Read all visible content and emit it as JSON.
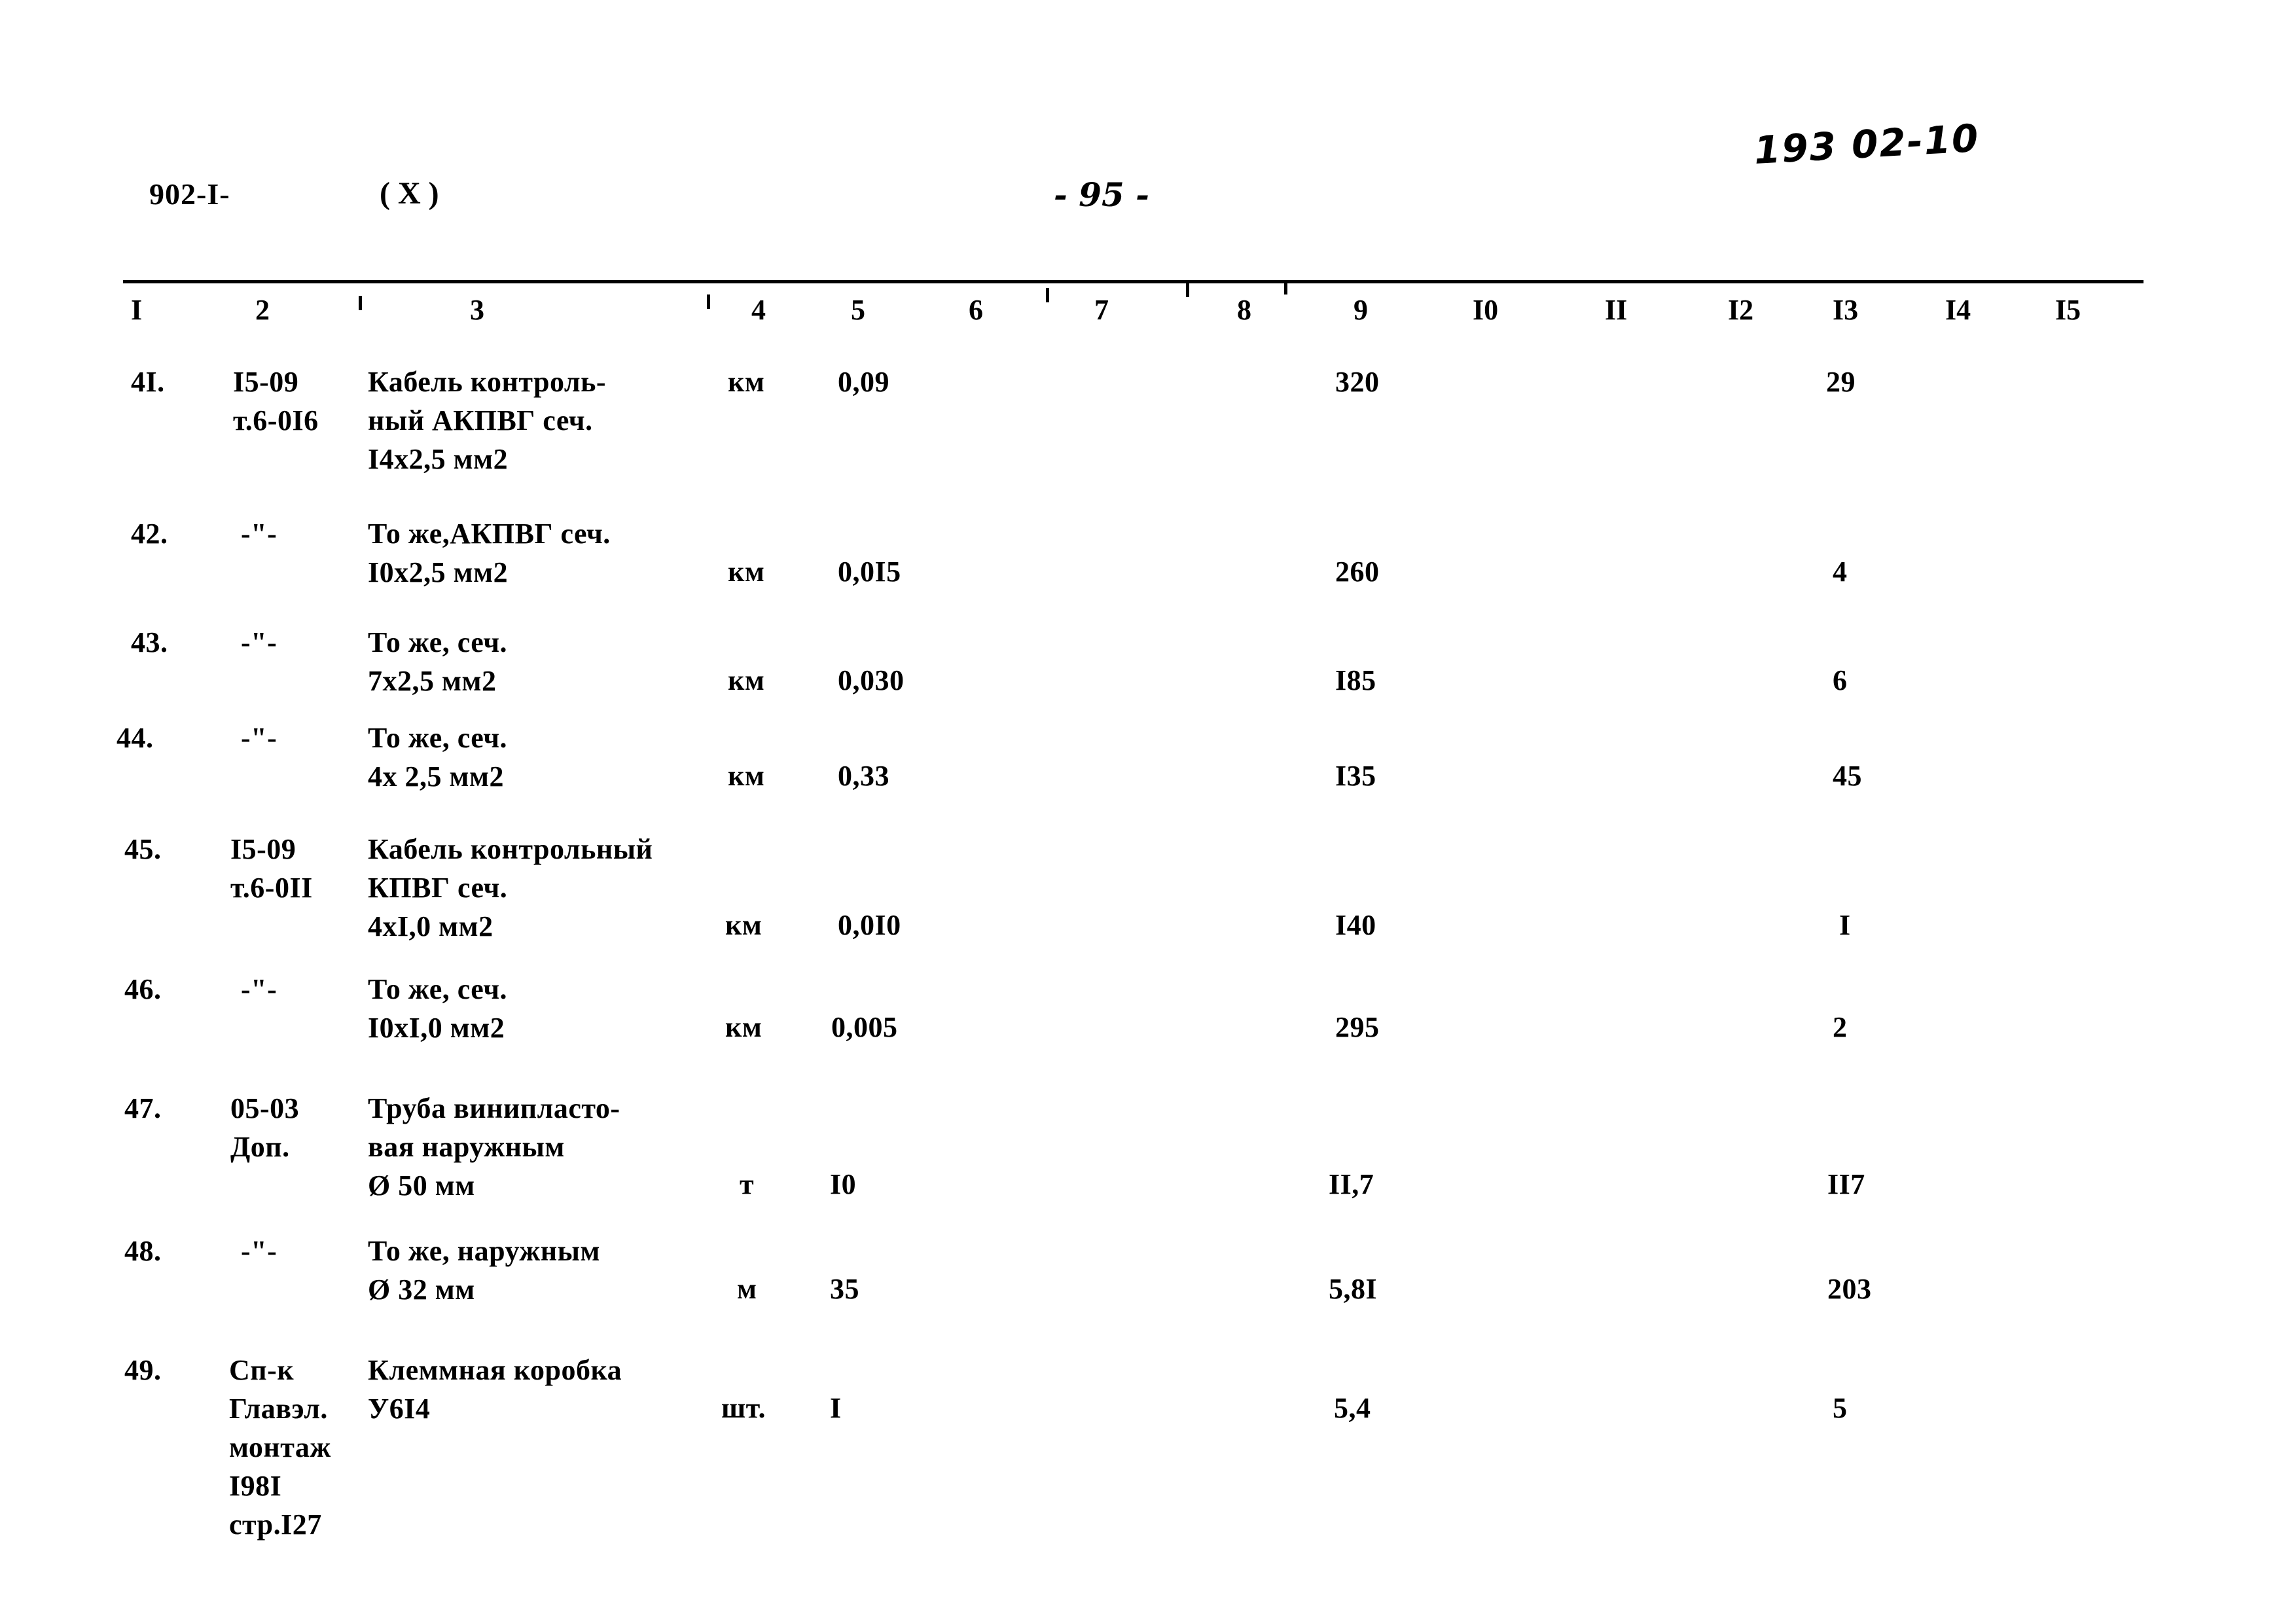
{
  "header": {
    "doc_code": "902-I-",
    "variant": "( X )",
    "page_number": "- 95 -",
    "handwritten_note": "193 02-10"
  },
  "table": {
    "column_headers": [
      "I",
      "2",
      "3",
      "4",
      "5",
      "6",
      "7",
      "8",
      "9",
      "I0",
      "II",
      "I2",
      "I3",
      "I4",
      "I5"
    ],
    "rows": [
      {
        "num": "4I.",
        "code": "I5-09\nт.6-0I6",
        "name": "Кабель контроль-\nный АКПВГ сеч.\nI4x2,5 мм2",
        "unit": "км",
        "qty": "0,09",
        "col9": "320",
        "col13": "29"
      },
      {
        "num": "42.",
        "code": "-\"-",
        "name": "То же,АКПВГ сеч.\nI0x2,5 мм2",
        "unit": "км",
        "qty": "0,0I5",
        "col9": "260",
        "col13": "4"
      },
      {
        "num": "43.",
        "code": "-\"-",
        "name": "То же, сеч.\n7x2,5 мм2",
        "unit": "км",
        "qty": "0,030",
        "col9": "I85",
        "col13": "6"
      },
      {
        "num": "44.",
        "code": "-\"-",
        "name": "То же, сеч.\n4x 2,5 мм2",
        "unit": "км",
        "qty": "0,33",
        "col9": "I35",
        "col13": "45"
      },
      {
        "num": "45.",
        "code": "I5-09\nт.6-0II",
        "name": "Кабель контрольный\nКПВГ сеч.\n4xI,0 мм2",
        "unit": "км",
        "qty": "0,0I0",
        "col9": "I40",
        "col13": "I"
      },
      {
        "num": "46.",
        "code": "-\"-",
        "name": "То же, сеч.\nI0xI,0 мм2",
        "unit": "км",
        "qty": "0,005",
        "col9": "295",
        "col13": "2"
      },
      {
        "num": "47.",
        "code": "05-03\nДоп.",
        "name": "Труба винипласто-\nвая наружным\nØ 50 мм",
        "unit": "т",
        "qty": "I0",
        "col9": "II,7",
        "col13": "II7"
      },
      {
        "num": "48.",
        "code": "-\"-",
        "name": "То же, наружным\nØ 32 мм",
        "unit": "м",
        "qty": "35",
        "col9": "5,8I",
        "col13": "203"
      },
      {
        "num": "49.",
        "code": "Сп-к\nГлавэл.\nмонтаж\nI98I\nстр.I27",
        "name": "Клеммная коробка\nУ6I4",
        "unit": "шт.",
        "qty": "I",
        "col9": "5,4",
        "col13": "5"
      }
    ]
  }
}
